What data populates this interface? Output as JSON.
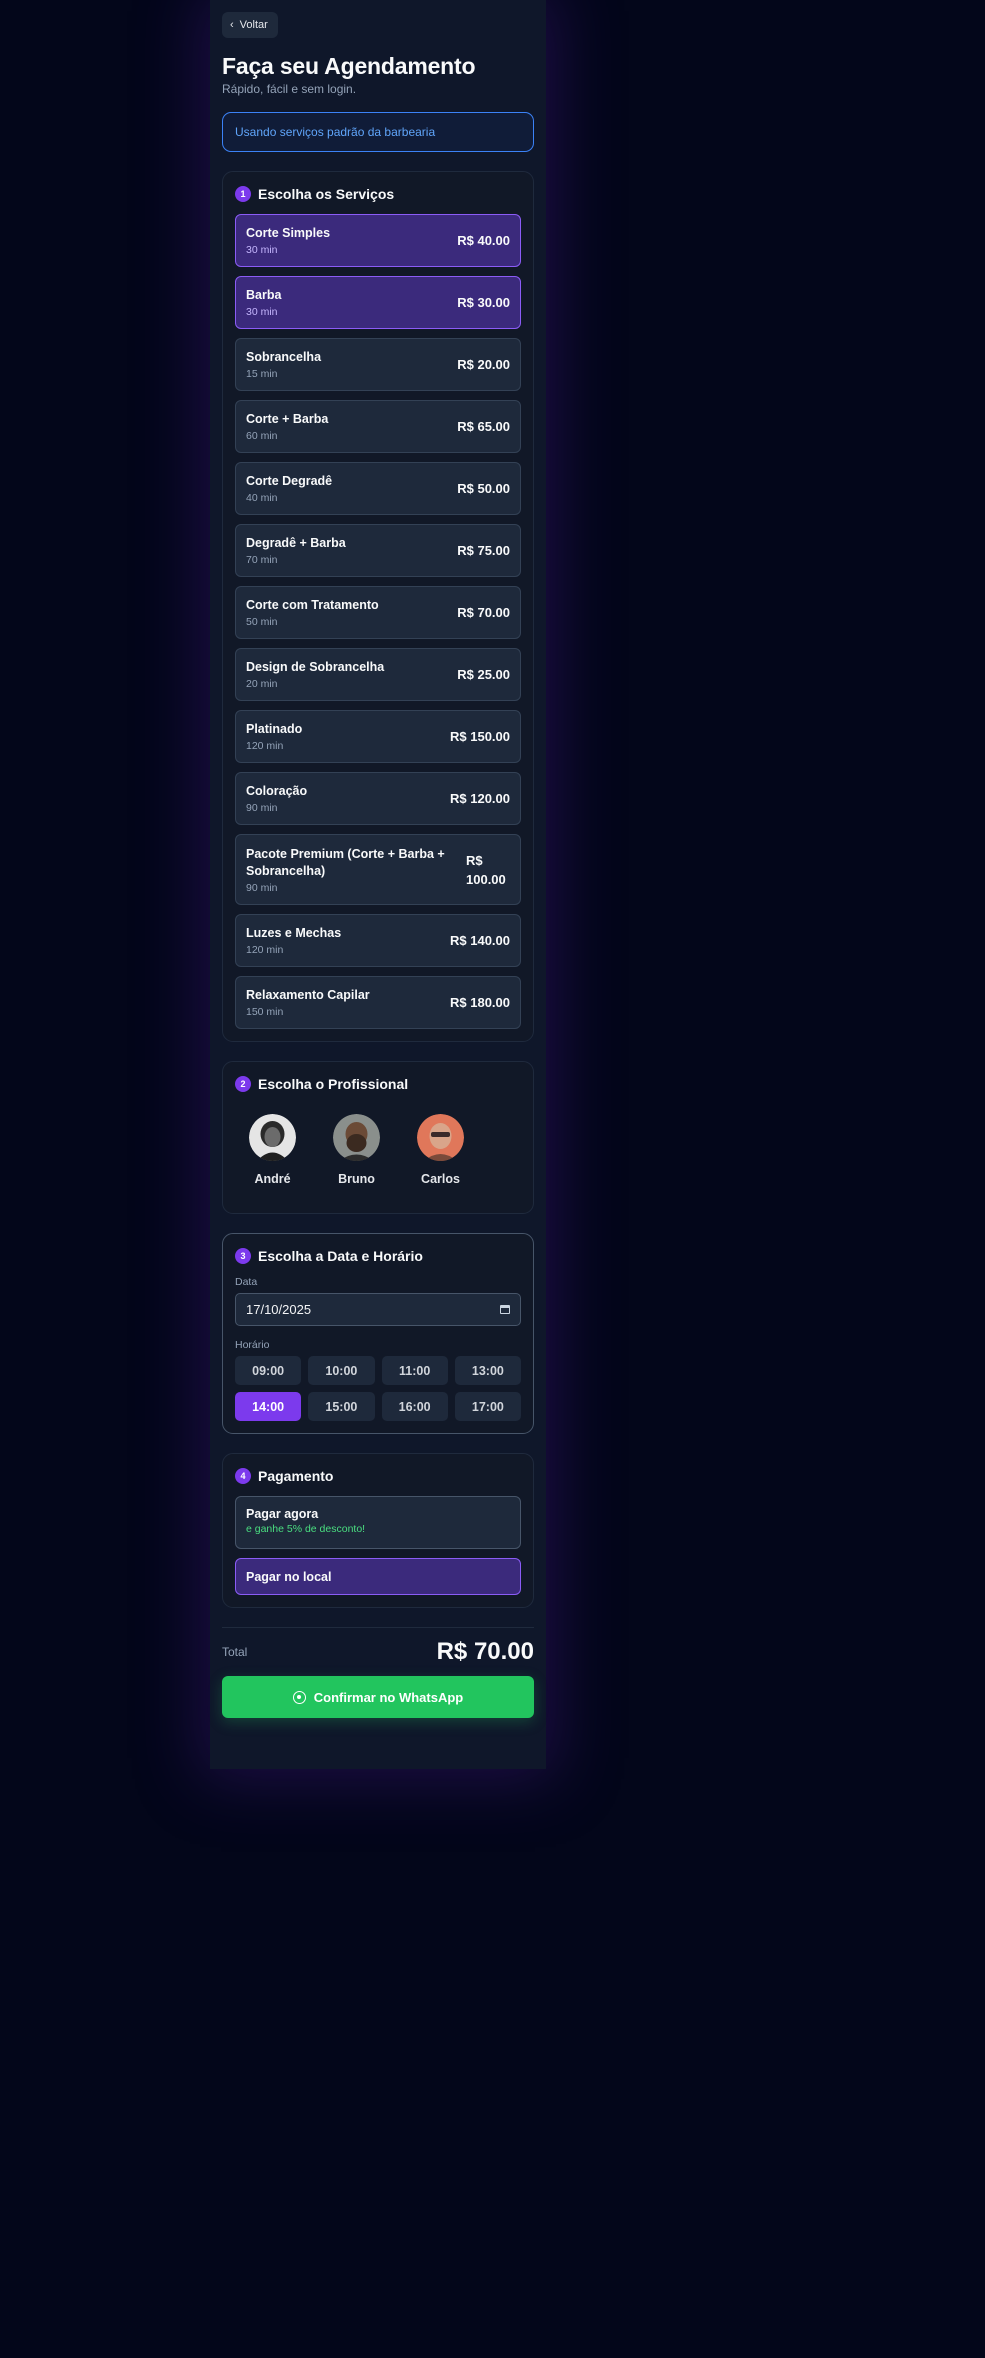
{
  "header": {
    "back_label": "Voltar",
    "title": "Faça seu Agendamento",
    "subtitle": "Rápido, fácil e sem login."
  },
  "info_box": {
    "text": "Usando serviços padrão da barbearia"
  },
  "services_section": {
    "step": "1",
    "title": "Escolha os Serviços",
    "items": [
      {
        "name": "Corte Simples",
        "duration": "30 min",
        "price": "R$ 40.00",
        "selected": true
      },
      {
        "name": "Barba",
        "duration": "30 min",
        "price": "R$ 30.00",
        "selected": true
      },
      {
        "name": "Sobrancelha",
        "duration": "15 min",
        "price": "R$ 20.00",
        "selected": false
      },
      {
        "name": "Corte + Barba",
        "duration": "60 min",
        "price": "R$ 65.00",
        "selected": false
      },
      {
        "name": "Corte Degradê",
        "duration": "40 min",
        "price": "R$ 50.00",
        "selected": false
      },
      {
        "name": "Degradê + Barba",
        "duration": "70 min",
        "price": "R$ 75.00",
        "selected": false
      },
      {
        "name": "Corte com Tratamento",
        "duration": "50 min",
        "price": "R$ 70.00",
        "selected": false
      },
      {
        "name": "Design de Sobrancelha",
        "duration": "20 min",
        "price": "R$ 25.00",
        "selected": false
      },
      {
        "name": "Platinado",
        "duration": "120 min",
        "price": "R$ 150.00",
        "selected": false
      },
      {
        "name": "Coloração",
        "duration": "90 min",
        "price": "R$ 120.00",
        "selected": false
      },
      {
        "name": "Pacote Premium (Corte + Barba + Sobrancelha)",
        "duration": "90 min",
        "price": "R$ 100.00",
        "selected": false
      },
      {
        "name": "Luzes e Mechas",
        "duration": "120 min",
        "price": "R$ 140.00",
        "selected": false
      },
      {
        "name": "Relaxamento Capilar",
        "duration": "150 min",
        "price": "R$ 180.00",
        "selected": false
      }
    ]
  },
  "professional_section": {
    "step": "2",
    "title": "Escolha o Profissional",
    "professionals": [
      {
        "name": "André",
        "selected": true
      },
      {
        "name": "Bruno",
        "selected": false
      },
      {
        "name": "Carlos",
        "selected": false
      }
    ]
  },
  "datetime_section": {
    "step": "3",
    "title": "Escolha a Data e Horário",
    "date_label": "Data",
    "date_value": "17/10/2025",
    "time_label": "Horário",
    "times": [
      "09:00",
      "10:00",
      "11:00",
      "13:00",
      "14:00",
      "15:00",
      "16:00",
      "17:00"
    ],
    "selected_time": "14:00"
  },
  "payment_section": {
    "step": "4",
    "title": "Pagamento",
    "pay_now_label": "Pagar agora",
    "pay_now_note": "e ganhe 5% de desconto!",
    "pay_local_label": "Pagar no local",
    "selected": "local"
  },
  "footer": {
    "total_label": "Total",
    "total_value": "R$ 70.00",
    "confirm_label": "Confirmar no WhatsApp"
  },
  "colors": {
    "background": "#03061a",
    "panel": "#0f172a",
    "accent": "#7c3aed",
    "selected_fill": "#3b2a7c",
    "info_blue": "#3b82f6",
    "whatsapp_green": "#22c55e",
    "discount_green": "#4ade80"
  }
}
